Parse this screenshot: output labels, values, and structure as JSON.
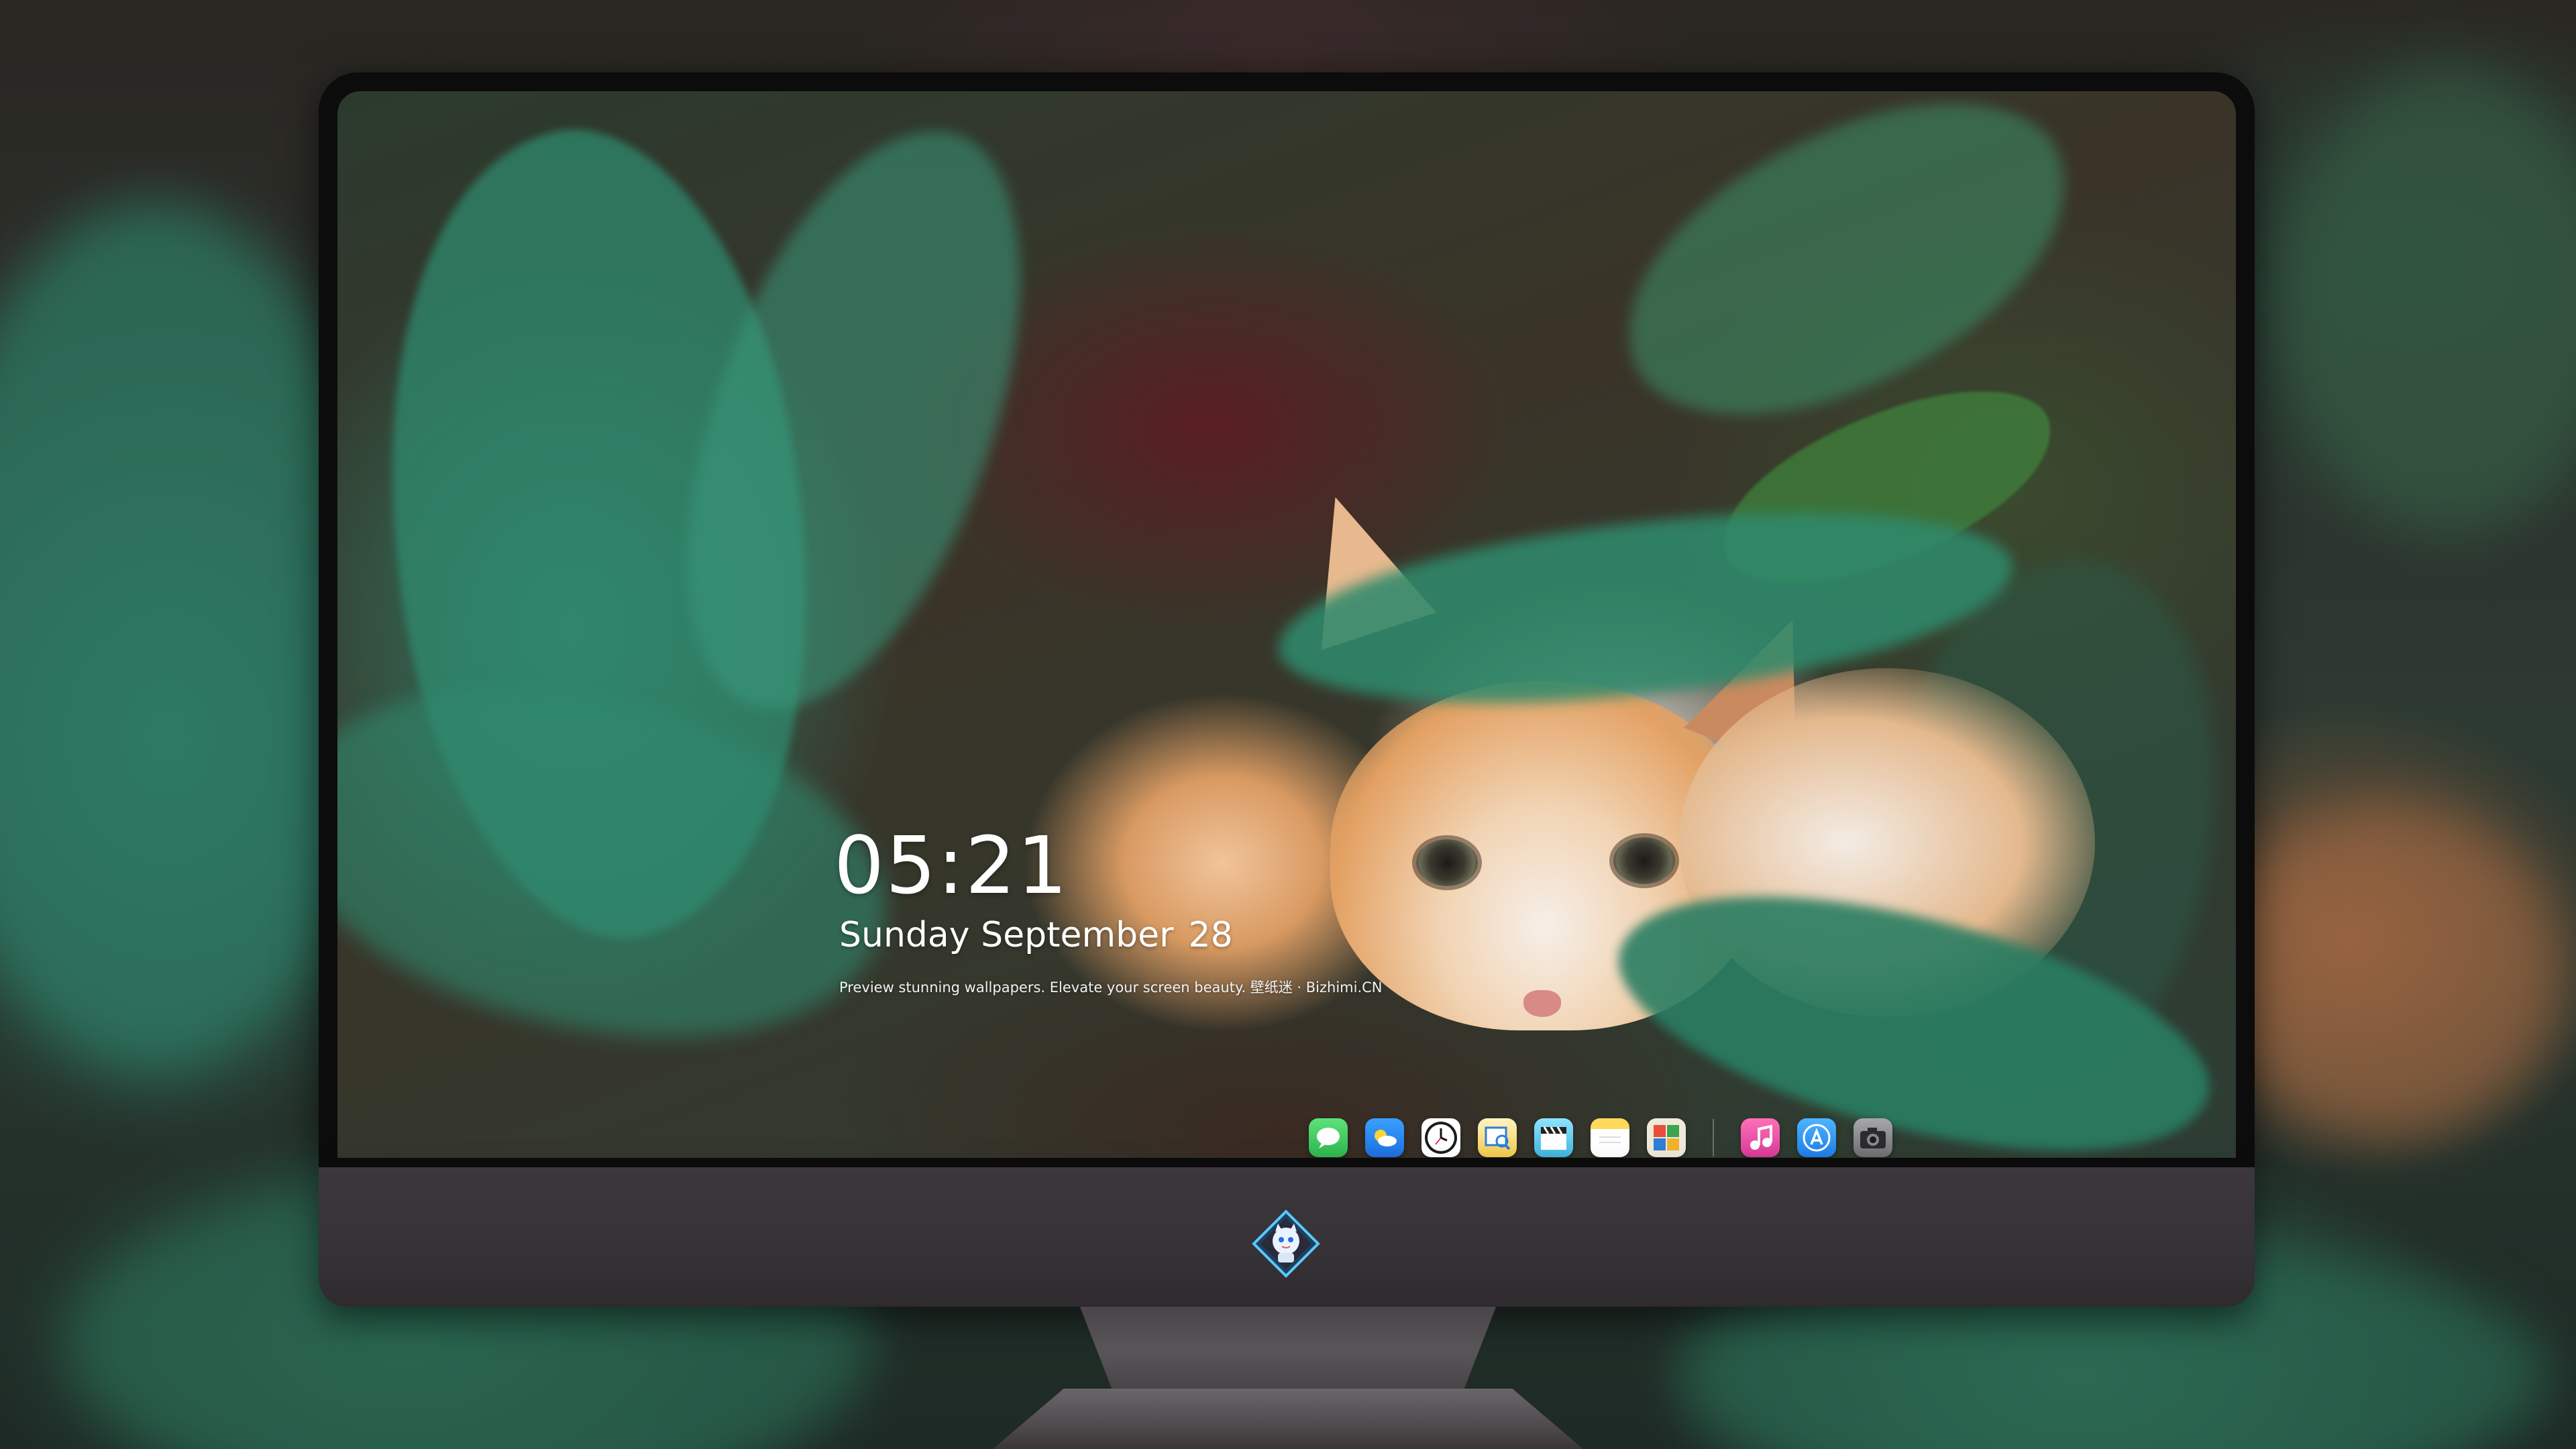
{
  "lock_screen": {
    "time": "05:21",
    "date_weekday_month": "Sunday September",
    "date_day": "28",
    "tagline": "Preview stunning wallpapers. Elevate your screen beauty. 壁纸迷 · Bizhimi.CN"
  },
  "dock": {
    "apps": [
      {
        "name": "messages-icon",
        "color": "#34c759"
      },
      {
        "name": "weather-icon",
        "color": "#1e90ff"
      },
      {
        "name": "clock-icon",
        "color": "#1c1c1e"
      },
      {
        "name": "preview-icon",
        "color": "#f2c94c"
      },
      {
        "name": "clapper-icon",
        "color": "#4fc3e8"
      },
      {
        "name": "notes-icon",
        "color": "#ffd24d"
      },
      {
        "name": "photo-booth-icon",
        "color": "#e9e3d2"
      },
      {
        "name": "music-icon",
        "color": "#e84aa0"
      },
      {
        "name": "app-store-icon",
        "color": "#1d8cf8"
      },
      {
        "name": "camera-icon",
        "color": "#8e8e93"
      }
    ]
  },
  "monitor": {
    "logo": "mascot-logo-icon"
  }
}
